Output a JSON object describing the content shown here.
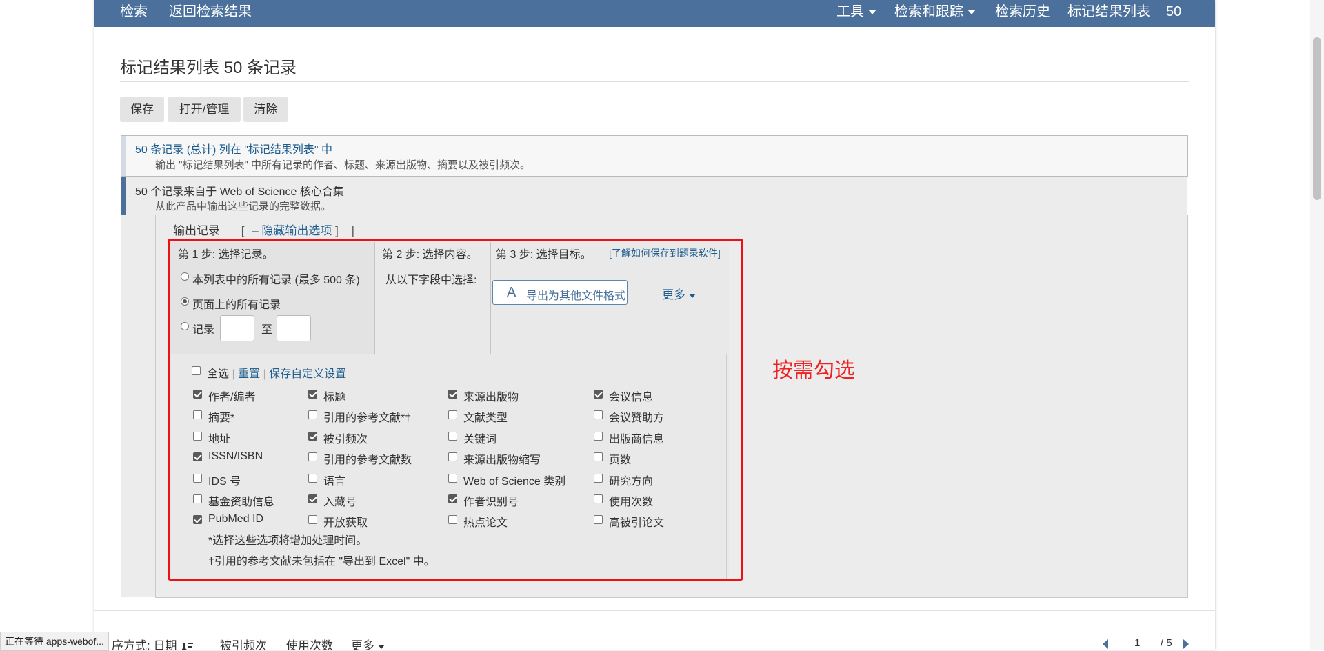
{
  "topbar": {
    "search": "检索",
    "back_to_results": "返回检索结果",
    "tools": "工具",
    "search_and_track": "检索和跟踪",
    "search_history": "检索历史",
    "marked_list": "标记结果列表",
    "marked_count": "50"
  },
  "page_title": "标记结果列表 50 条记录",
  "actions": {
    "save": "保存",
    "open_manage": "打开/管理",
    "clear": "清除"
  },
  "summary": {
    "link_text": "50 条记录 (总计) 列在 \"标记结果列表\" 中",
    "description": "输出 \"标记结果列表\" 中所有记录的作者、标题、来源出版物、摘要以及被引频次。"
  },
  "collection": {
    "title": "50 个记录来自于 Web of Science 核心合集",
    "description": "从此产品中输出这些记录的完整数据。"
  },
  "export": {
    "header": "输出记录",
    "bracket_open": "[",
    "toggle_symbol": "–",
    "hide_options": "隐藏输出选项",
    "bracket_close": "]",
    "pipe": "|"
  },
  "step1": {
    "title": "第 1 步: 选择记录。",
    "opt_all_in_list": "本列表中的所有记录 (最多 500 条)",
    "opt_all_on_page": "页面上的所有记录",
    "opt_records": "记录",
    "to": "至",
    "selected": "all_on_page",
    "from_value": "",
    "to_value": ""
  },
  "step2": {
    "title": "第 2 步: 选择内容。",
    "subtitle": "从以下字段中选择:"
  },
  "step3": {
    "title": "第 3 步: 选择目标。",
    "learn_link": "[了解如何保存到题录软件]",
    "export_button": "导出为其他文件格式",
    "export_icon": "A",
    "more": "更多"
  },
  "fields": {
    "select_all": "全选",
    "reset": "重置",
    "save_custom": "保存自定义设置",
    "rows": [
      [
        {
          "label": "作者/编者",
          "checked": true
        },
        {
          "label": "标题",
          "checked": true
        },
        {
          "label": "来源出版物",
          "checked": true
        },
        {
          "label": "会议信息",
          "checked": true
        }
      ],
      [
        {
          "label": "摘要*",
          "checked": false
        },
        {
          "label": "引用的参考文献*†",
          "checked": false
        },
        {
          "label": "文献类型",
          "checked": false
        },
        {
          "label": "会议赞助方",
          "checked": false
        }
      ],
      [
        {
          "label": "地址",
          "checked": false
        },
        {
          "label": "被引频次",
          "checked": true
        },
        {
          "label": "关键词",
          "checked": false
        },
        {
          "label": "出版商信息",
          "checked": false
        }
      ],
      [
        {
          "label": "ISSN/ISBN",
          "checked": true
        },
        {
          "label": "引用的参考文献数",
          "checked": false
        },
        {
          "label": "来源出版物缩写",
          "checked": false
        },
        {
          "label": "页数",
          "checked": false
        }
      ],
      [
        {
          "label": "IDS 号",
          "checked": false
        },
        {
          "label": "语言",
          "checked": false
        },
        {
          "label": "Web of Science 类别",
          "checked": false
        },
        {
          "label": "研究方向",
          "checked": false
        }
      ],
      [
        {
          "label": "基金资助信息",
          "checked": false
        },
        {
          "label": "入藏号",
          "checked": true
        },
        {
          "label": "作者识别号",
          "checked": true
        },
        {
          "label": "使用次数",
          "checked": false
        }
      ],
      [
        {
          "label": "PubMed ID",
          "checked": true
        },
        {
          "label": "开放获取",
          "checked": false
        },
        {
          "label": "热点论文",
          "checked": false
        },
        {
          "label": "高被引论文",
          "checked": false
        }
      ]
    ],
    "note1": "*选择这些选项将增加处理时间。",
    "note2": "†引用的参考文献未包括在 \"导出到 Excel\" 中。"
  },
  "annotation": {
    "text": "按需勾选",
    "color": "#ee2222"
  },
  "sortbar": {
    "sort_label": "序方式: 日期",
    "cited": "被引频次",
    "usage": "使用次数",
    "more": "更多"
  },
  "pager": {
    "current": "1",
    "total": "/ 5"
  },
  "status_tooltip": "正在等待 apps-webof...",
  "colors": {
    "topbar": "#4a709b",
    "link": "#1e5d8e",
    "highlight_box": "#ee1111"
  },
  "icons": {
    "dropdown": "chevron-down-icon",
    "sort": "sort-descending-icon",
    "pager_prev": "arrow-left-icon",
    "pager_next": "arrow-right-icon"
  }
}
